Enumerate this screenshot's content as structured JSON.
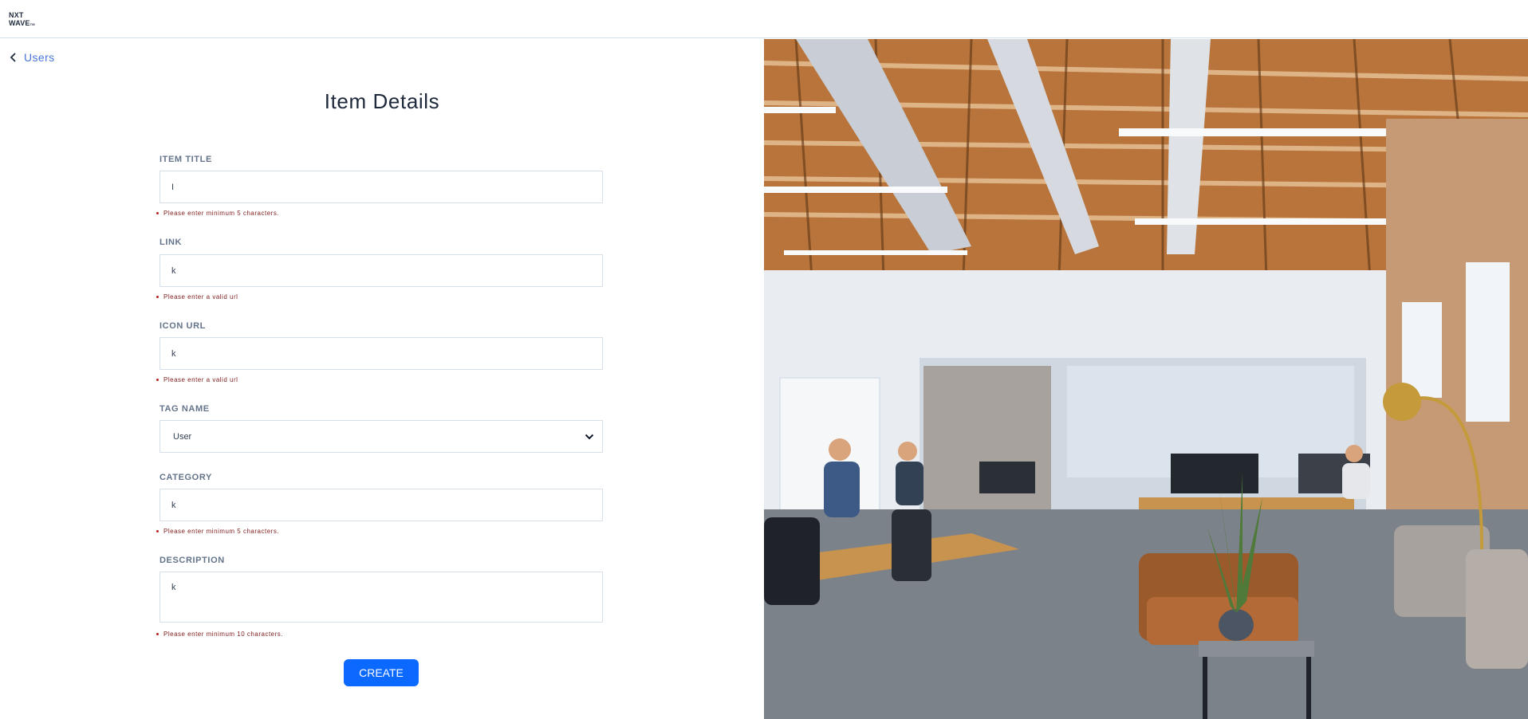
{
  "header": {
    "logo_line1": "NXT",
    "logo_line2": "WAVE",
    "logo_tm": "TM"
  },
  "nav": {
    "back_label": "Users"
  },
  "page_title": "Item Details",
  "form": {
    "item_title": {
      "label": "ITEM TITLE",
      "value": "I",
      "error": "Please enter minimum 5 characters."
    },
    "link": {
      "label": "LINK",
      "value": "k",
      "error": "Please enter a valid url"
    },
    "icon_url": {
      "label": "ICON URL",
      "value": "k",
      "error": "Please enter a valid url"
    },
    "tag_name": {
      "label": "TAG NAME",
      "selected": "User"
    },
    "category": {
      "label": "CATEGORY",
      "value": "k",
      "error": "Please enter minimum 5 characters."
    },
    "description": {
      "label": "DESCRIPTION",
      "value": "k",
      "error": "Please enter minimum 10 characters."
    },
    "submit_label": "CREATE"
  },
  "colors": {
    "accent": "#0b69ff",
    "link": "#4a76d9",
    "error": "#7f1d1d",
    "border": "#d7dfe9"
  },
  "icons": {
    "back": "chevron-left-icon",
    "select": "chevron-down-icon"
  }
}
